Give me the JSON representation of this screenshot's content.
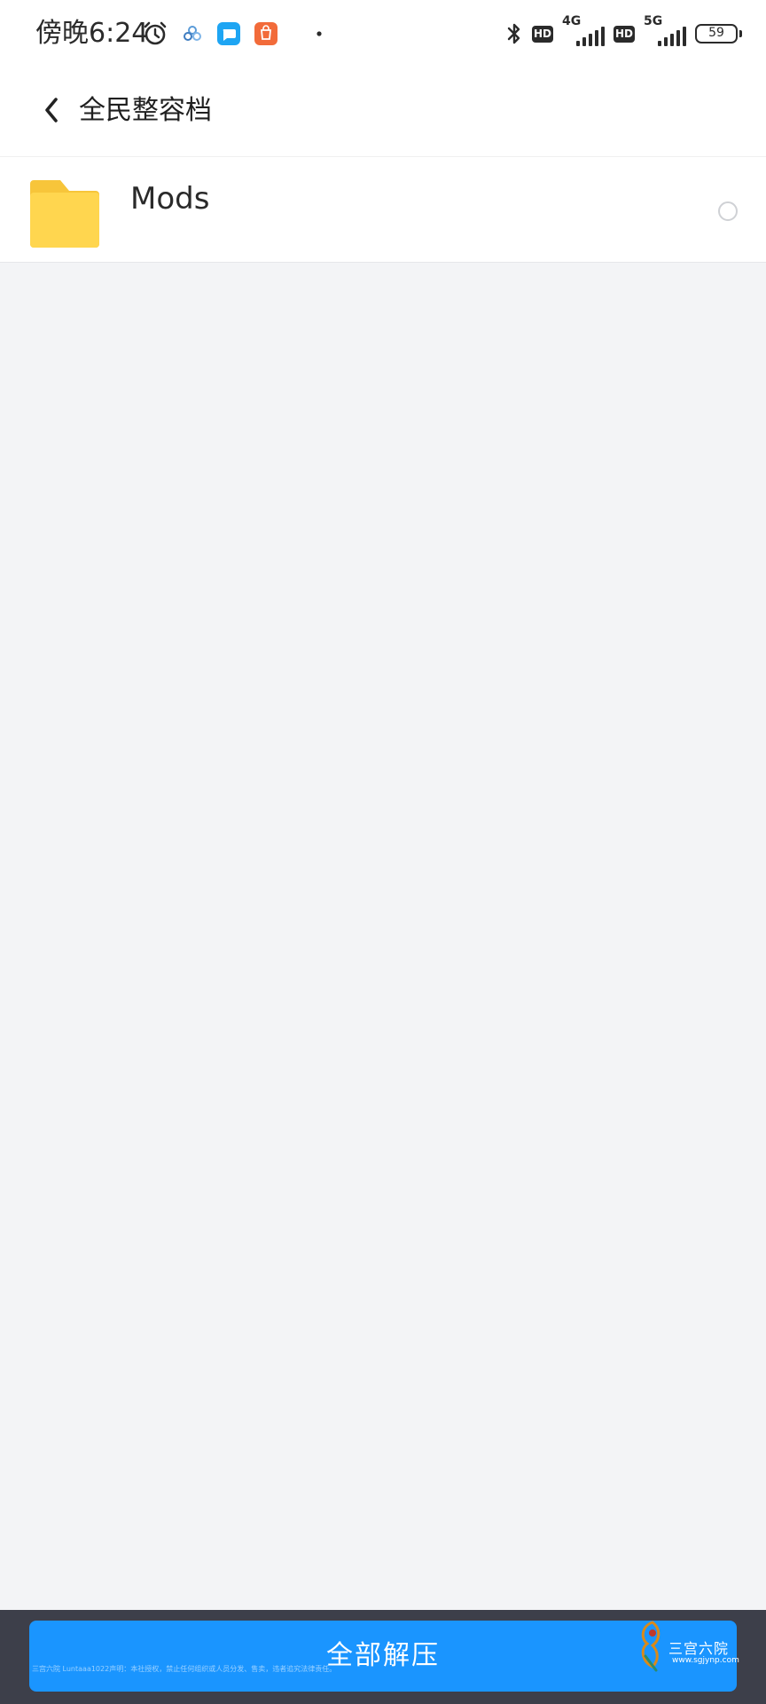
{
  "status_bar": {
    "time": "傍晚6:24",
    "network_1": "4G",
    "network_2": "5G",
    "battery": "59",
    "hd_1": "HD",
    "hd_2": "HD",
    "icons": [
      "alarm-icon",
      "cloud-app-icon",
      "chat-app-icon",
      "shop-app-icon",
      "notification-dot-icon",
      "bluetooth-icon",
      "hd-icon",
      "signal-icon",
      "battery-icon"
    ]
  },
  "header": {
    "back_icon": "chevron-left-icon",
    "title": "全民整容档"
  },
  "file_list": {
    "items": [
      {
        "name": "Mods",
        "icon": "folder-icon",
        "selected": false
      }
    ]
  },
  "bottom_bar": {
    "button_label": "全部解压",
    "disclaimer": "三宫六院 Luntaaa1022声明：本社授权，禁止任何组织或人员分发、售卖，违者追究法律责任。",
    "watermark_text": "三宫六院",
    "watermark_url": "www.sgjynp.com"
  },
  "colors": {
    "primary": "#1a95ff",
    "folder": "#ffd54f",
    "background": "#f3f4f6",
    "bottom_bar": "#3d3f4a"
  }
}
